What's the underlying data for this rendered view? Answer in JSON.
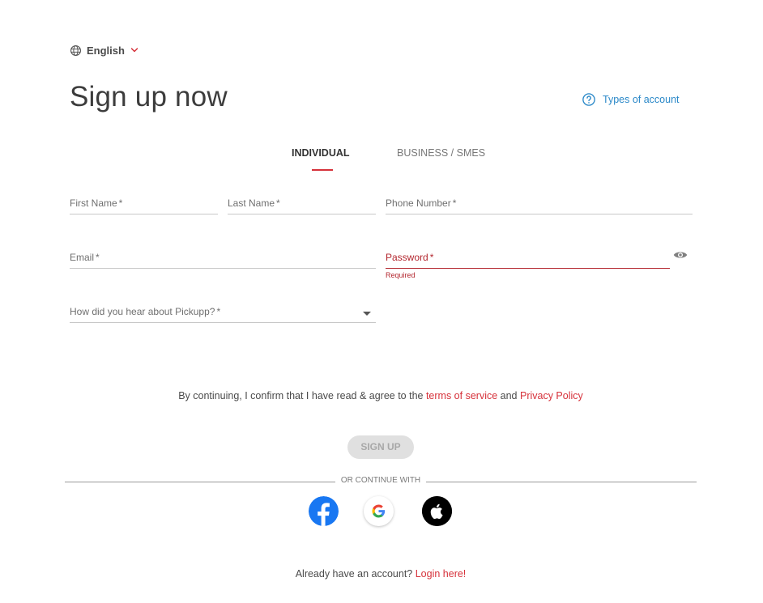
{
  "language": {
    "label": "English"
  },
  "header": {
    "title": "Sign up now",
    "types_link": "Types of account"
  },
  "tabs": [
    {
      "label": "INDIVIDUAL",
      "active": true
    },
    {
      "label": "BUSINESS / SMES",
      "active": false
    }
  ],
  "form": {
    "first_name": {
      "label": "First Name",
      "required": "*"
    },
    "last_name": {
      "label": "Last Name",
      "required": "*"
    },
    "phone": {
      "label": "Phone Number",
      "required": "*"
    },
    "email": {
      "label": "Email",
      "required": "*"
    },
    "password": {
      "label": "Password",
      "required": "*",
      "helper": "Required"
    },
    "heard_about": {
      "label": "How did you hear about Pickupp?",
      "required": "*"
    }
  },
  "terms": {
    "prefix": "By continuing, I confirm that I have read & agree to the ",
    "terms_link": "terms of service",
    "middle": " and ",
    "privacy_link": "Privacy Policy"
  },
  "signup_button": "SIGN UP",
  "divider_text": "OR CONTINUE WITH",
  "social": [
    "facebook-icon",
    "google-icon",
    "apple-icon"
  ],
  "login": {
    "prefix": "Already have an account? ",
    "link": "Login here!"
  },
  "colors": {
    "accent": "#d6313a",
    "link_blue": "#2a88c8",
    "error": "#b3262e",
    "facebook": "#1877f2"
  }
}
